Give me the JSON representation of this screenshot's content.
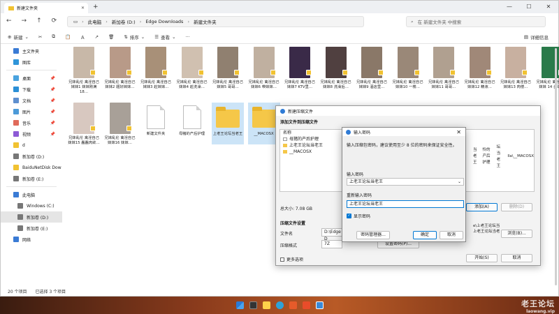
{
  "tab": {
    "title": "新建文件夹"
  },
  "address": {
    "segments": [
      "此电脑",
      "新加卷 (D:)",
      "Edge Downloads",
      "新建文件夹"
    ]
  },
  "search": {
    "placeholder": "在 新建文件夹 中搜索"
  },
  "toolbar": {
    "new": "新建",
    "sort": "排序",
    "view": "查看",
    "more": "···",
    "details": "详细信息"
  },
  "sidebar": {
    "items": [
      {
        "label": "主文件夹",
        "color": "#3a7bd5",
        "pin": ""
      },
      {
        "label": "图库",
        "color": "#2f95d9",
        "pin": ""
      },
      {
        "label": "桌面",
        "color": "#4aa3df",
        "pin": "📌"
      },
      {
        "label": "下载",
        "color": "#2b8fd6",
        "pin": "📌"
      },
      {
        "label": "文档",
        "color": "#5e8fcf",
        "pin": "📌"
      },
      {
        "label": "图片",
        "color": "#4c9ad8",
        "pin": "📌"
      },
      {
        "label": "音乐",
        "color": "#e06a5a",
        "pin": "📌"
      },
      {
        "label": "视频",
        "color": "#8d5ad6",
        "pin": "📌"
      },
      {
        "label": "d",
        "color": "#f1c232",
        "pin": ""
      },
      {
        "label": "新加卷 (D:)",
        "color": "#777",
        "pin": ""
      },
      {
        "label": "BaiduNetDisk Dow",
        "color": "#f1c232",
        "pin": ""
      },
      {
        "label": "新加卷 (E:)",
        "color": "#777",
        "pin": ""
      },
      {
        "label": "此电脑",
        "color": "#3a7bd5",
        "pin": ""
      },
      {
        "label": "Windows (C:)",
        "color": "#777",
        "pin": ""
      },
      {
        "label": "新加卷 (D:)",
        "color": "#777",
        "pin": ""
      },
      {
        "label": "新加卷 (E:)",
        "color": "#777",
        "pin": ""
      },
      {
        "label": "网络",
        "color": "#3a7bd5",
        "pin": ""
      }
    ]
  },
  "files": [
    {
      "name": "兄妹乱伦 禽淫自己妹妹1 妹妹刚满18…",
      "color": "#c8b8a8"
    },
    {
      "name": "兄妹乱伦 禽淫自己妹妹2 题好妹妹…",
      "color": "#b89a88"
    },
    {
      "name": "兄妹乱伦 禽淫自己妹妹3 趁妹妹…",
      "color": "#a89078"
    },
    {
      "name": "兄妹乱伦 禽淫自己妹妹4 趁洗澡…",
      "color": "#d0c0b0"
    },
    {
      "name": "兄妹乱伦 禽淫自己妹妹5 哥哥…",
      "color": "#908070"
    },
    {
      "name": "兄妹乱伦 禽淫自己妹妹6 带妹妹…",
      "color": "#c0b0a0"
    },
    {
      "name": "兄妹乱伦 禽淫自己妹妹7 KTV里…",
      "color": "#3a2a48"
    },
    {
      "name": "兄妹乱伦 禽淫自己妹妹8 洗澡后…",
      "color": "#504040"
    },
    {
      "name": "兄妹乱伦 禽淫自己妹妹9 酒店里…",
      "color": "#8a7868"
    },
    {
      "name": "兄妹乱伦 禽淫自己妹妹10 一楼…",
      "color": "#9a8878"
    },
    {
      "name": "兄妹乱伦 禽淫自己妹妹11 哥哥…",
      "color": "#b0a090"
    },
    {
      "name": "兄妹乱伦 禽淫自己妹妹12 精液…",
      "color": "#a08878"
    },
    {
      "name": "兄妹乱伦 禽淫自己妹妹13 肉偿…",
      "color": "#c8b0a0"
    },
    {
      "name": "兄妹乱伦 禽淫自己妹妹 14 台球…",
      "color": "#2a7a4a"
    },
    {
      "name": "兄妹乱伦 禽淫自己妹妹15 蠢蠢肉欲…",
      "color": "#d8c8c0"
    },
    {
      "name": "兄妹乱伦 禽淫自己妹妹16 妹妹…",
      "color": "#a8a098"
    }
  ],
  "docs": [
    {
      "name": "新建文件夹"
    },
    {
      "name": "母猪的产后护理"
    }
  ],
  "folders": [
    {
      "name": "上老王论坛当老王"
    },
    {
      "name": "__MACOSX"
    }
  ],
  "status": {
    "count": "20 个项目",
    "selected": "已选择 3 个项目"
  },
  "archive": {
    "title": "新建压缩文件",
    "heading": "添加文件到压缩文件",
    "col_name": "名称",
    "list": [
      "母猪的产后护理",
      "上老王论坛当老王",
      "__MACOSX"
    ],
    "size": "总大小: 7.08 GB",
    "add": "添加(A)",
    "delete": "删除(D)",
    "settings": "压缩文件设置",
    "file_name_label": "文件名",
    "file_name": "D:\\Edge D",
    "format_label": "压缩格式",
    "format": "7Z",
    "browse": "浏览(B)...",
    "more_options": "更多选项",
    "right_list": [
      "当老王",
      "怜的产后护理",
      "坛当老王",
      "lla\\__MACOSX"
    ],
    "right_paths": [
      "e\\上老王论坛当",
      "上老王论坛当老"
    ],
    "password_btn": "设置密码(P)...",
    "start": "开始(S)",
    "cancel": "取消"
  },
  "password": {
    "title": "输入密码",
    "hint": "输入压缩包密码，建议使用至少 8 位的密码来保证安全性。",
    "enter_label": "输入密码",
    "enter_value": "上老王论坛当老王",
    "reenter_label": "重新输入密码",
    "reenter_value": "上老王论坛当老王",
    "show": "显示密码",
    "manager": "密码管理器...",
    "ok": "确定",
    "cancel": "取消"
  },
  "watermark": {
    "cn": "老王论坛",
    "url": "laowang.vip"
  }
}
